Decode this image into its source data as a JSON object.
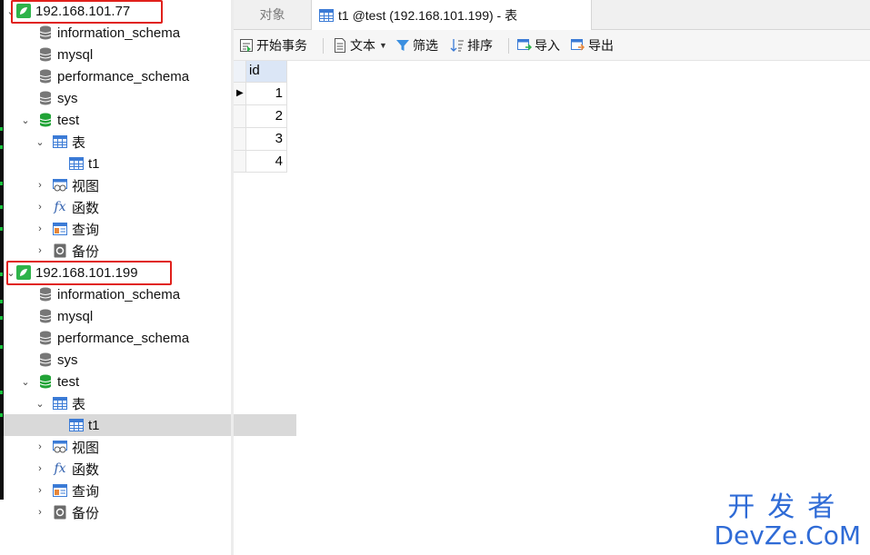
{
  "tree": {
    "connections": [
      {
        "name": "192.168.101.77",
        "databases": [
          "information_schema",
          "mysql",
          "performance_schema",
          "sys"
        ],
        "open_db": "test",
        "groups": {
          "tables": "表",
          "views": "视图",
          "functions": "函数",
          "queries": "查询",
          "backups": "备份"
        },
        "table": "t1"
      },
      {
        "name": "192.168.101.199",
        "databases": [
          "information_schema",
          "mysql",
          "performance_schema",
          "sys"
        ],
        "open_db": "test",
        "groups": {
          "tables": "表",
          "views": "视图",
          "functions": "函数",
          "queries": "查询",
          "backups": "备份"
        },
        "table": "t1"
      }
    ]
  },
  "tabs": {
    "objects": "对象",
    "active": "t1 @test (192.168.101.199) - 表"
  },
  "toolbar": {
    "begin_transaction": "开始事务",
    "text": "文本",
    "filter": "筛选",
    "sort": "排序",
    "import": "导入",
    "export": "导出"
  },
  "grid": {
    "column": "id",
    "rows": [
      "1",
      "2",
      "3",
      "4"
    ]
  },
  "watermark": {
    "cn": "开发者",
    "en": "DevZe.CoM"
  },
  "colors": {
    "highlight_box": "#e0201b",
    "db_open": "#21a336",
    "header_bg": "#dbe6f6",
    "watermark": "#2f6bd6"
  }
}
